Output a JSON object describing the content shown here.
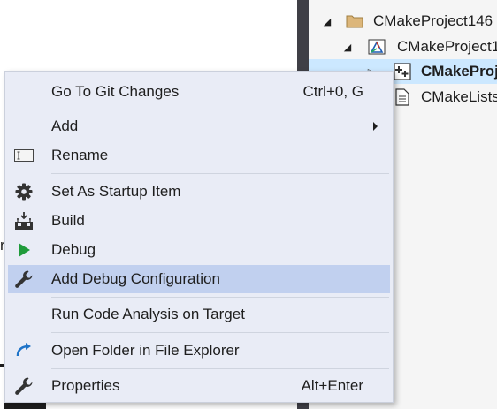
{
  "solution_explorer": {
    "items": [
      {
        "label": "CMakeProject146",
        "expanded": true,
        "icon": "folder-icon"
      },
      {
        "label": "CMakeProject1",
        "expanded": true,
        "icon": "cmake-project-icon"
      },
      {
        "label": "CMakeProj",
        "expanded": false,
        "icon": "cpp-source-icon",
        "selected": true,
        "bold": true
      },
      {
        "label": "CMakeLists",
        "icon": "document-icon"
      }
    ]
  },
  "background_fragment": "r",
  "context_menu": {
    "items": [
      {
        "label": "Go To Git Changes",
        "shortcut": "Ctrl+0, G",
        "icon": ""
      },
      {
        "label": "Add",
        "submenu": true,
        "icon": ""
      },
      {
        "label": "Rename",
        "icon": "rename-icon"
      },
      {
        "label": "Set As Startup Item",
        "icon": "gear-icon"
      },
      {
        "label": "Build",
        "icon": "build-icon"
      },
      {
        "label": "Debug",
        "icon": "play-icon"
      },
      {
        "label": "Add Debug Configuration",
        "icon": "wrench-icon",
        "highlighted": true
      },
      {
        "label": "Run Code Analysis on Target",
        "icon": ""
      },
      {
        "label": "Open Folder in File Explorer",
        "icon": "open-folder-arrow-icon"
      },
      {
        "label": "Properties",
        "shortcut": "Alt+Enter",
        "icon": "wrench-icon"
      }
    ]
  },
  "colors": {
    "menu_background": "#e9ecf6",
    "menu_highlight": "#c1d0ef",
    "tree_selection": "#cce8ff",
    "play_green": "#1f9b3b",
    "open_folder_blue": "#1e73c8"
  }
}
